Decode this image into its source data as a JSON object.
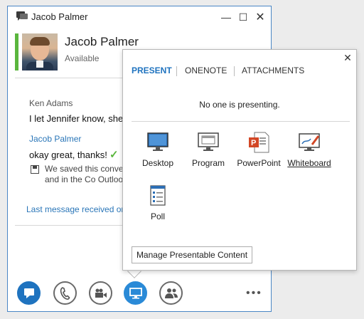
{
  "window": {
    "title": "Jacob Palmer",
    "min_glyph": "—",
    "max_glyph": "☐",
    "close_glyph": "✕"
  },
  "contact": {
    "name": "Jacob Palmer",
    "status": "Available",
    "presence_color": "#5ab63d"
  },
  "conversation": {
    "messages": [
      {
        "sender": "Ken Adams",
        "text": "I let Jennifer know, she"
      },
      {
        "sender": "Jacob Palmer",
        "text": "okay great, thanks!"
      }
    ],
    "check_glyph": "✓",
    "saved_notice": "We saved this conve in Lync and in the Co Outlook.",
    "last_message": "Last message received on"
  },
  "toolbar": {
    "buttons": [
      {
        "icon": "im-icon",
        "active": true
      },
      {
        "icon": "phone-icon",
        "active": false
      },
      {
        "icon": "video-icon",
        "active": false
      },
      {
        "icon": "present-icon",
        "active": true
      },
      {
        "icon": "people-icon",
        "active": false
      }
    ],
    "more_glyph": "•••"
  },
  "present_flyout": {
    "close_glyph": "✕",
    "tabs": [
      "PRESENT",
      "ONENOTE",
      "ATTACHMENTS"
    ],
    "active_tab": "PRESENT",
    "status": "No one is presenting.",
    "options": [
      {
        "label": "Desktop",
        "icon": "desktop-icon"
      },
      {
        "label": "Program",
        "icon": "program-icon"
      },
      {
        "label": "PowerPoint",
        "icon": "powerpoint-icon"
      },
      {
        "label": "Whiteboard",
        "icon": "whiteboard-icon"
      },
      {
        "label": "Poll",
        "icon": "poll-icon"
      }
    ],
    "manage_button": "Manage Presentable Content"
  },
  "colors": {
    "accent": "#1f73bf",
    "window_border": "#4a86c5",
    "link": "#2a76b8"
  }
}
